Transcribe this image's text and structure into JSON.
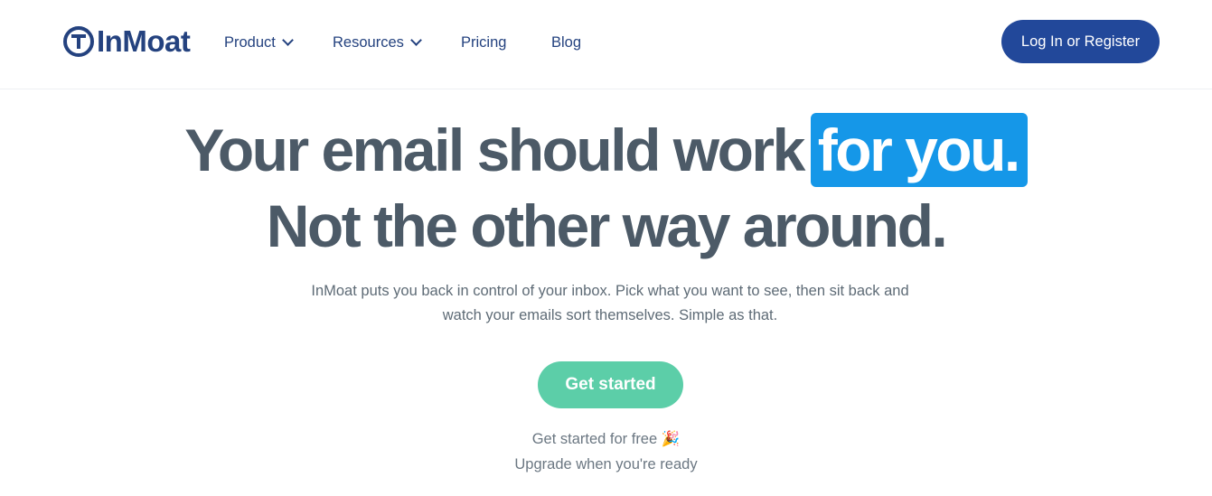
{
  "brand": {
    "name": "InMoat",
    "color": "#24427f"
  },
  "nav": {
    "items": [
      {
        "label": "Product",
        "has_dropdown": true
      },
      {
        "label": "Resources",
        "has_dropdown": true
      },
      {
        "label": "Pricing",
        "has_dropdown": false
      },
      {
        "label": "Blog",
        "has_dropdown": false
      }
    ],
    "login_label": "Log In or Register"
  },
  "hero": {
    "headline_line1": "Your email should work",
    "headline_highlight": "for you.",
    "headline_line2": "Not the other way around.",
    "subtext": "InMoat puts you back in control of your inbox. Pick what you want to see, then sit back and watch your emails sort themselves. Simple as that.",
    "cta_label": "Get started",
    "note_line1": "Get started for free 🎉",
    "note_line2": "Upgrade when you're ready"
  },
  "colors": {
    "highlight": "#1597e8",
    "cta": "#5ccea8",
    "login_button": "#22489a",
    "headline_text": "#4c5a67"
  }
}
